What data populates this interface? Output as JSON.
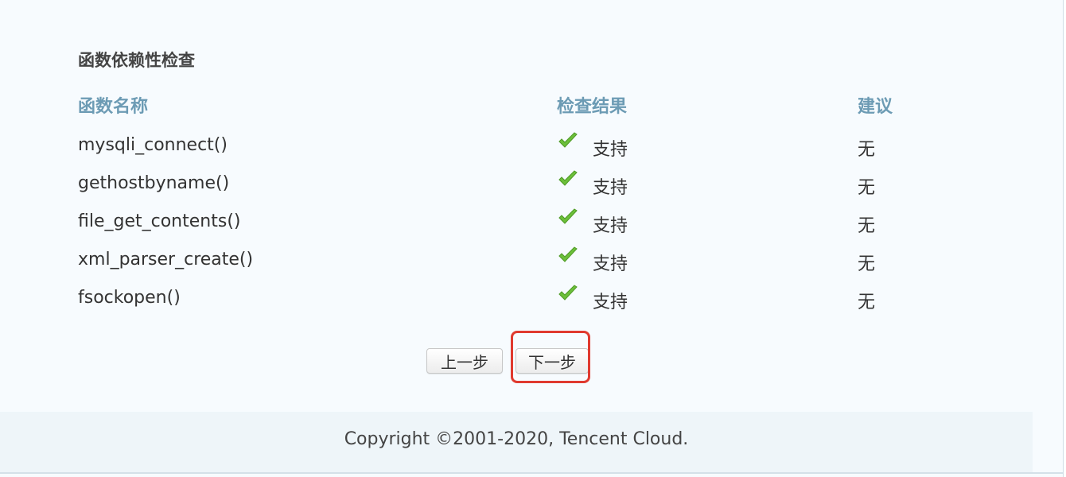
{
  "section_title": "函数依赖性检查",
  "columns": {
    "name": "函数名称",
    "result": "检查结果",
    "advice": "建议"
  },
  "rows": [
    {
      "name": "mysqli_connect()",
      "result": "支持",
      "advice": "无",
      "status_icon": "green-check"
    },
    {
      "name": "gethostbyname()",
      "result": "支持",
      "advice": "无",
      "status_icon": "green-check"
    },
    {
      "name": "file_get_contents()",
      "result": "支持",
      "advice": "无",
      "status_icon": "green-check"
    },
    {
      "name": "xml_parser_create()",
      "result": "支持",
      "advice": "无",
      "status_icon": "green-check"
    },
    {
      "name": "fsockopen()",
      "result": "支持",
      "advice": "无",
      "status_icon": "green-check"
    }
  ],
  "buttons": {
    "prev": "上一步",
    "next": "下一步"
  },
  "highlight_color": "#e03a2f",
  "header_color": "#6c9bb4",
  "check_color": "#6cbf3a",
  "footer": "Copyright ©2001-2020, Tencent Cloud."
}
